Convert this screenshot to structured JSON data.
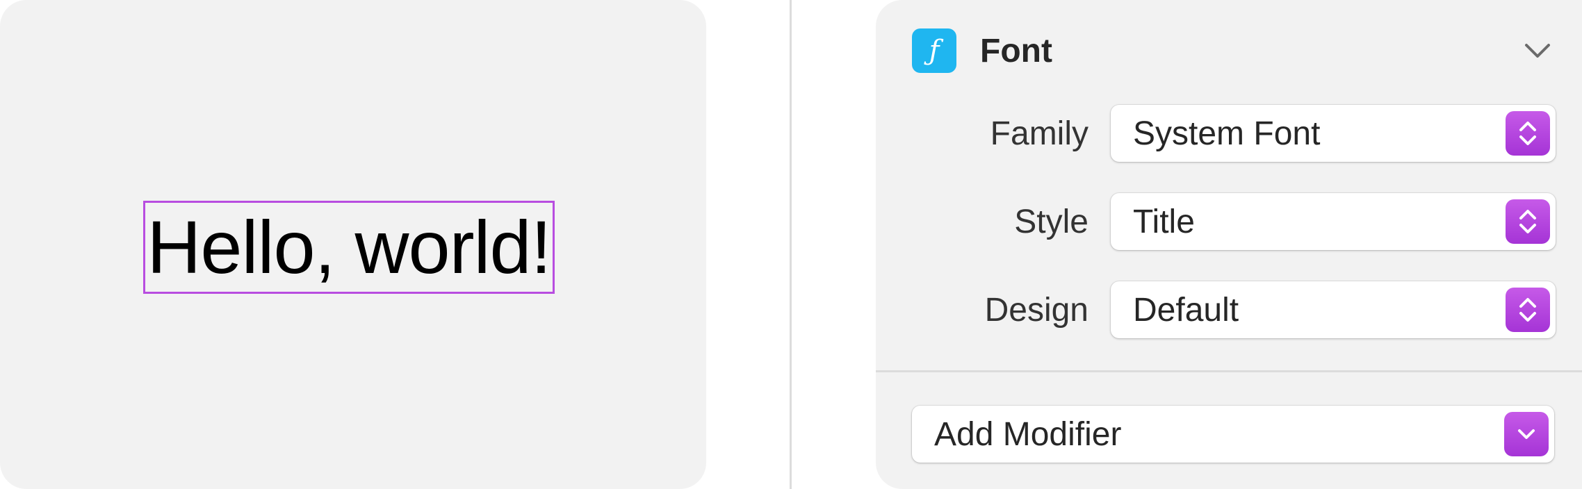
{
  "preview": {
    "text": "Hello, world!",
    "selection_color": "#b84de0"
  },
  "inspector": {
    "section": {
      "title": "Font",
      "icon": "f-italic-icon",
      "icon_glyph": "ƒ",
      "badge_color": "#1fb6f0",
      "expanded": true
    },
    "rows": [
      {
        "label": "Family",
        "value": "System Font"
      },
      {
        "label": "Style",
        "value": "Title"
      },
      {
        "label": "Design",
        "value": "Default"
      }
    ],
    "add_modifier_label": "Add Modifier",
    "accent_color": "#b040de"
  }
}
